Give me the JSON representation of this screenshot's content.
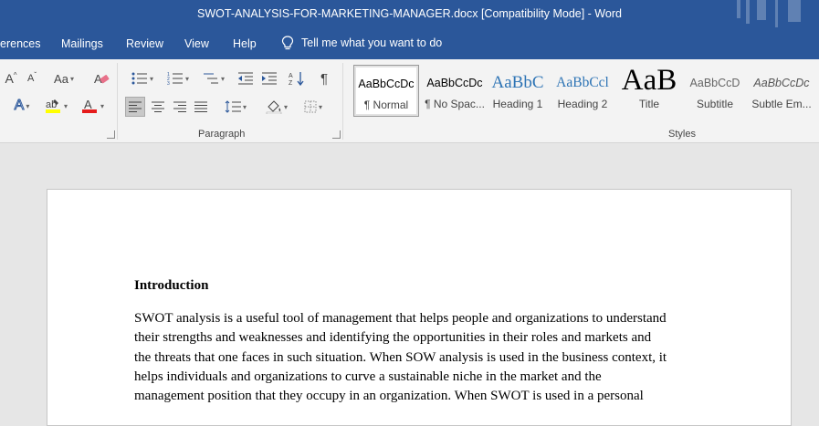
{
  "window": {
    "title": "SWOT-ANALYSIS-FOR-MARKETING-MANAGER.docx [Compatibility Mode]  -  Word"
  },
  "tabs": [
    {
      "label": "erences"
    },
    {
      "label": "Mailings"
    },
    {
      "label": "Review"
    },
    {
      "label": "View"
    },
    {
      "label": "Help"
    }
  ],
  "tell_me": {
    "label": "Tell me what you want to do",
    "icon": "lightbulb-icon"
  },
  "ribbon": {
    "font_group": {
      "grow_font": "A",
      "shrink_font": "A",
      "change_case": "Aa",
      "text_effects": "A",
      "highlight_color": "#ffff00",
      "font_color": "#ff0000"
    },
    "paragraph_group": {
      "label": "Paragraph",
      "pilcrow": "¶",
      "active_alignment": "align-left"
    },
    "styles_group": {
      "label": "Styles",
      "styles": [
        {
          "preview": "AaBbCcDc",
          "name": "¶ Normal",
          "selected": true
        },
        {
          "preview": "AaBbCcDc",
          "name": "¶ No Spac..."
        },
        {
          "preview": "AaBbC",
          "name": "Heading 1"
        },
        {
          "preview": "AaBbCcl",
          "name": "Heading 2"
        },
        {
          "preview": "AaB",
          "name": "Title"
        },
        {
          "preview": "AaBbCcD",
          "name": "Subtitle"
        },
        {
          "preview": "AaBbCcDc",
          "name": "Subtle Em..."
        }
      ]
    }
  },
  "document": {
    "heading": "Introduction",
    "lines": [
      "SWOT analysis is a useful tool of management that helps people and organizations to understand",
      "their strengths and weaknesses and identifying the opportunities in their roles and markets and",
      "the threats that one faces in such situation. When SOW analysis is used in the business context, it",
      "helps individuals and organizations to curve a sustainable niche in the market and the",
      "management position that they occupy in an organization. When SWOT is used in a personal"
    ]
  }
}
